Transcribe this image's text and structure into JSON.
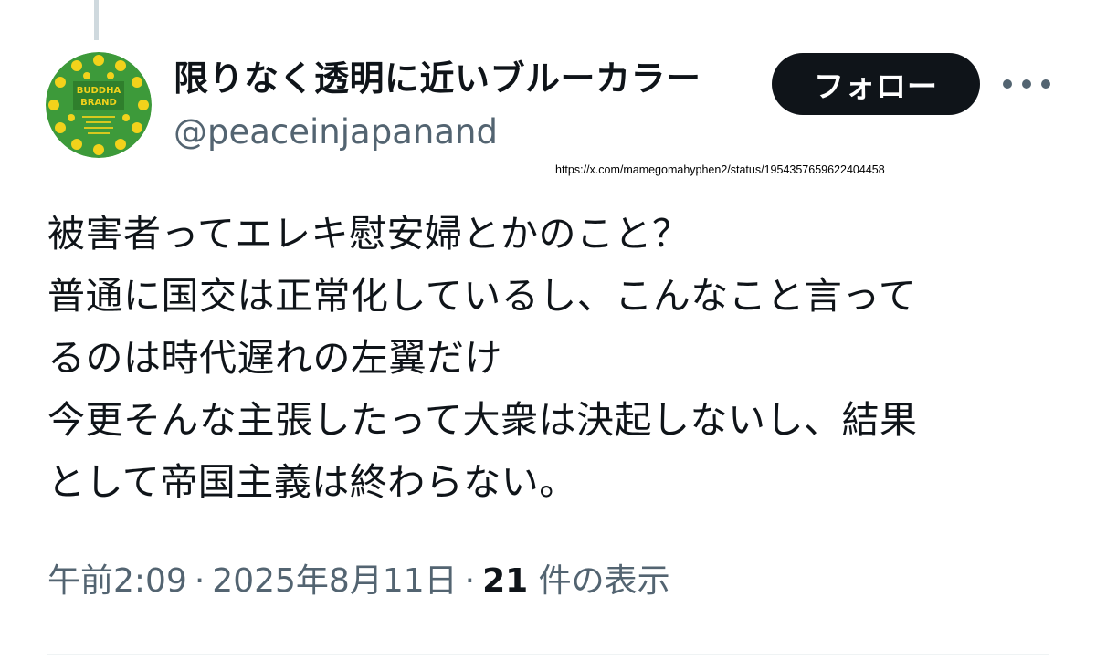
{
  "author": {
    "display_name": "限りなく透明に近いブルーカラー",
    "handle": "@peaceinjapanand",
    "avatar_text": {
      "line1": "BUDDHA",
      "line2": "BRAND"
    }
  },
  "actions": {
    "follow_label": "フォロー",
    "more_icon": "more-horizontal-icon"
  },
  "source_url": "https://x.com/mamegomahyphen2/status/1954357659622404458",
  "tweet": {
    "lines": [
      "被害者ってエレキ慰安婦とかのこと？",
      "普通に国交は正常化しているし、こんなこと言って",
      "るのは時代遅れの左翼だけ",
      "今更そんな主張したって大衆は決起しないし、結果",
      "として帝国主義は終わらない。"
    ]
  },
  "meta": {
    "time": "午前2:09",
    "separator": "·",
    "date": "2025年8月11日",
    "views_count": "21",
    "views_label": "件の表示"
  },
  "colors": {
    "avatar_green": "#3d9a3a",
    "avatar_yellow": "#f2d21b",
    "button_bg": "#0f1419",
    "secondary_text": "#536471"
  }
}
